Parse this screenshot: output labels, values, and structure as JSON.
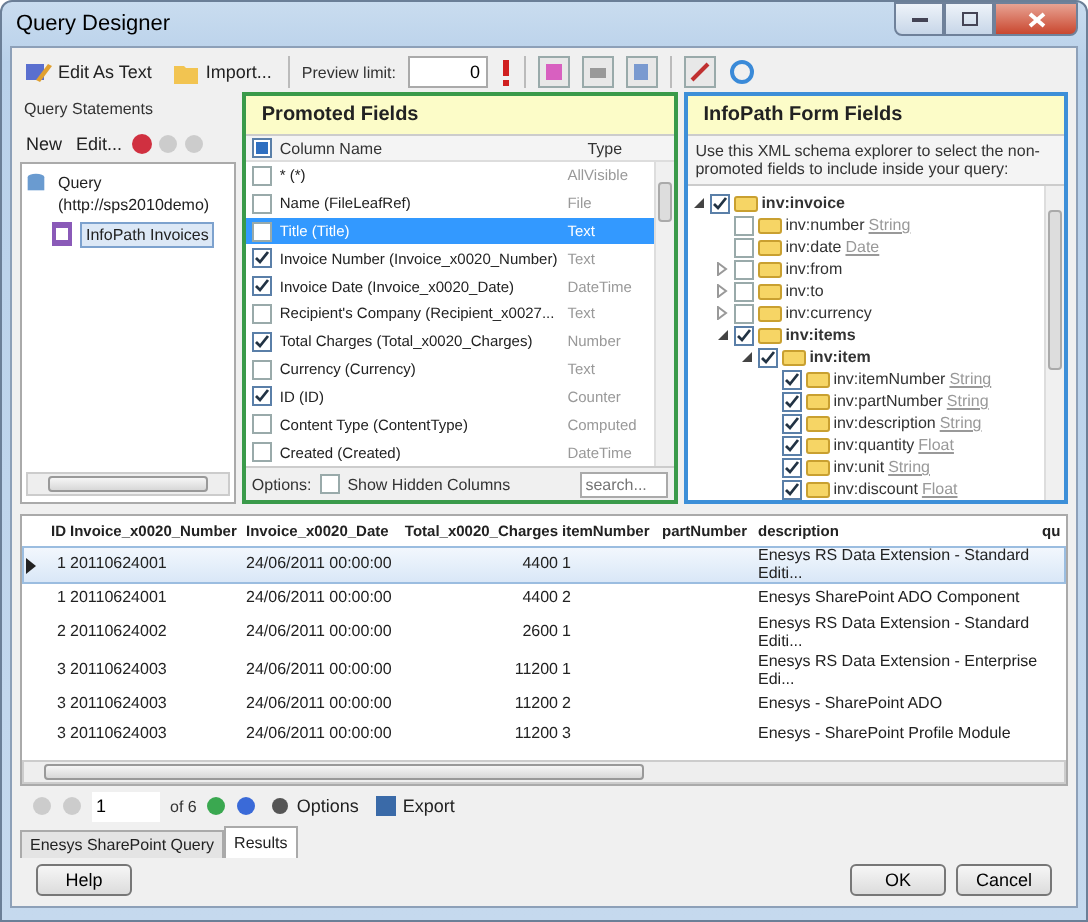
{
  "window": {
    "title": "Query Designer"
  },
  "toolbar": {
    "buttons": [
      {
        "label": "Edit As Text",
        "kind": "edit"
      },
      {
        "label": "Import...",
        "kind": "import"
      }
    ],
    "preview_label": "Preview limit:",
    "preview_value": "0"
  },
  "query_statements": {
    "title": "Query Statements",
    "actions": [
      "New",
      "Edit..."
    ],
    "tree": [
      {
        "label": "Query (http://sps2010demo)",
        "selected": false,
        "children": [
          {
            "label": "InfoPath Invoices",
            "selected": true
          }
        ]
      }
    ]
  },
  "promoted_fields": {
    "title": "Promoted Fields",
    "header_partial": true,
    "columns": [
      "Column Name",
      "Type"
    ],
    "rows": [
      {
        "name": "* (*)",
        "type": "AllVisible",
        "checked": false,
        "selected": false
      },
      {
        "name": "Name (FileLeafRef)",
        "type": "File",
        "checked": false,
        "selected": false
      },
      {
        "name": "Title (Title)",
        "type": "Text",
        "checked": false,
        "selected": true
      },
      {
        "name": "Invoice Number (Invoice_x0020_Number)",
        "type": "Text",
        "checked": true,
        "selected": false
      },
      {
        "name": "Invoice Date (Invoice_x0020_Date)",
        "type": "DateTime",
        "checked": true,
        "selected": false
      },
      {
        "name": "Recipient's Company (Recipient_x0027...",
        "type": "Text",
        "checked": false,
        "selected": false
      },
      {
        "name": "Total Charges (Total_x0020_Charges)",
        "type": "Number",
        "checked": true,
        "selected": false
      },
      {
        "name": "Currency (Currency)",
        "type": "Text",
        "checked": false,
        "selected": false
      },
      {
        "name": "ID (ID)",
        "type": "Counter",
        "checked": true,
        "selected": false
      },
      {
        "name": "Content Type (ContentType)",
        "type": "Computed",
        "checked": false,
        "selected": false
      },
      {
        "name": "Created (Created)",
        "type": "DateTime",
        "checked": false,
        "selected": false
      }
    ],
    "options_label": "Options:",
    "show_hidden": {
      "label": "Show Hidden Columns",
      "checked": false
    },
    "search_placeholder": "search..."
  },
  "infopath_fields": {
    "title": "InfoPath Form Fields",
    "description": "Use this XML schema explorer to select the non-promoted fields to include inside your query:",
    "tree": [
      {
        "name": "inv:invoice",
        "bold": true,
        "checked": true,
        "expanded": true,
        "children": [
          {
            "name": "inv:number",
            "type": "String",
            "bold": false,
            "checked": false
          },
          {
            "name": "inv:date",
            "type": "Date",
            "bold": false,
            "checked": false
          },
          {
            "name": "inv:from",
            "bold": false,
            "checked": false,
            "expanded": false
          },
          {
            "name": "inv:to",
            "bold": false,
            "checked": false,
            "expanded": false
          },
          {
            "name": "inv:currency",
            "bold": false,
            "checked": false,
            "expanded": false
          },
          {
            "name": "inv:items",
            "bold": true,
            "checked": true,
            "expanded": true,
            "children": [
              {
                "name": "inv:item",
                "bold": true,
                "checked": true,
                "expanded": true,
                "children": [
                  {
                    "name": "inv:itemNumber",
                    "type": "String",
                    "bold": false,
                    "checked": true
                  },
                  {
                    "name": "inv:partNumber",
                    "type": "String",
                    "bold": false,
                    "checked": true
                  },
                  {
                    "name": "inv:description",
                    "type": "String",
                    "bold": false,
                    "checked": true
                  },
                  {
                    "name": "inv:quantity",
                    "type": "Float",
                    "bold": false,
                    "checked": true
                  },
                  {
                    "name": "inv:unit",
                    "type": "String",
                    "bold": false,
                    "checked": true
                  },
                  {
                    "name": "inv:discount",
                    "type": "Float",
                    "bold": false,
                    "checked": true
                  }
                ]
              }
            ]
          }
        ]
      }
    ]
  },
  "results": {
    "columns": [
      {
        "label": "ID",
        "align_right": true
      },
      {
        "label": "Invoice_x0020_Number",
        "align_right": false
      },
      {
        "label": "Invoice_x0020_Date",
        "align_right": false
      },
      {
        "label": "Total_x0020_Charges",
        "align_right": true
      },
      {
        "label": "itemNumber",
        "align_right": false
      },
      {
        "label": "partNumber",
        "align_right": false
      },
      {
        "label": "description",
        "align_right": false
      },
      {
        "label": "qu",
        "align_right": false
      }
    ],
    "rows": [
      {
        "selected": true,
        "cells": [
          "1",
          "20110624001",
          "24/06/2011 00:00:00",
          "4400",
          "1",
          "",
          "Enesys RS Data Extension - Standard Editi..."
        ]
      },
      {
        "selected": false,
        "cells": [
          "1",
          "20110624001",
          "24/06/2011 00:00:00",
          "4400",
          "2",
          "",
          "Enesys SharePoint ADO Component"
        ]
      },
      {
        "selected": false,
        "cells": [
          "2",
          "20110624002",
          "24/06/2011 00:00:00",
          "2600",
          "1",
          "",
          "Enesys RS Data Extension - Standard Editi..."
        ]
      },
      {
        "selected": false,
        "cells": [
          "3",
          "20110624003",
          "24/06/2011 00:00:00",
          "11200",
          "1",
          "",
          "Enesys RS Data Extension - Enterprise Edi..."
        ]
      },
      {
        "selected": false,
        "cells": [
          "3",
          "20110624003",
          "24/06/2011 00:00:00",
          "11200",
          "2",
          "",
          "Enesys - SharePoint ADO"
        ]
      },
      {
        "selected": false,
        "cells": [
          "3",
          "20110624003",
          "24/06/2011 00:00:00",
          "11200",
          "3",
          "",
          "Enesys - SharePoint Profile Module"
        ]
      }
    ]
  },
  "pager": {
    "page": "1",
    "total": "of 6",
    "options": "Options",
    "export": "Export"
  },
  "tabs": [
    {
      "label": "Enesys SharePoint Query",
      "selected": false
    },
    {
      "label": "Results",
      "selected": true
    }
  ],
  "buttons": {
    "left": [
      "Help"
    ],
    "right": [
      "OK",
      "Cancel"
    ]
  }
}
